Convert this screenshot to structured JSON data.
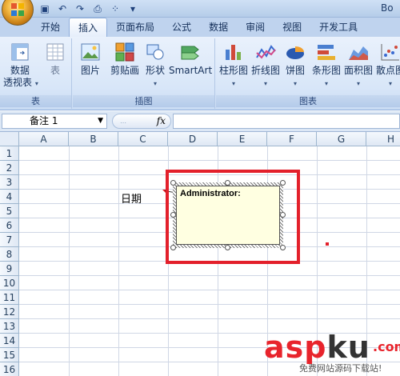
{
  "window": {
    "title_fragment": "Bo"
  },
  "tabs": [
    {
      "label": "开始",
      "active": false
    },
    {
      "label": "插入",
      "active": true
    },
    {
      "label": "页面布局",
      "active": false
    },
    {
      "label": "公式",
      "active": false
    },
    {
      "label": "数据",
      "active": false
    },
    {
      "label": "审阅",
      "active": false
    },
    {
      "label": "视图",
      "active": false
    },
    {
      "label": "开发工具",
      "active": false
    }
  ],
  "ribbon": {
    "groups": {
      "tables": {
        "label": "表",
        "pivot_line1": "数据",
        "pivot_line2": "透视表",
        "table": "表"
      },
      "illustrations": {
        "label": "插图",
        "picture": "图片",
        "clipart": "剪贴画",
        "shapes": "形状",
        "smartart": "SmartArt"
      },
      "charts": {
        "label": "图表",
        "column": "柱形图",
        "line": "折线图",
        "pie": "饼图",
        "bar": "条形图",
        "area": "面积图",
        "scatter": "散点图"
      }
    }
  },
  "formula_bar": {
    "name_box": "备注 1",
    "fx": "fx",
    "formula": ""
  },
  "columns": [
    "A",
    "B",
    "C",
    "D",
    "E",
    "F",
    "G",
    "H"
  ],
  "rows": [
    "1",
    "2",
    "3",
    "4",
    "5",
    "6",
    "7",
    "8",
    "9",
    "10",
    "11",
    "12",
    "13",
    "14",
    "15",
    "16"
  ],
  "cells": {
    "C4": "日期"
  },
  "comment": {
    "author": "Administrator:",
    "text": ""
  },
  "colors": {
    "highlight_box": "#e3202b",
    "comment_bg": "#ffffe1",
    "active_tab": "#ffffff"
  },
  "watermark": {
    "brand_a": "asp",
    "brand_k": "ku",
    "tld": ".com",
    "subtitle": "免费网站源码下载站!"
  }
}
